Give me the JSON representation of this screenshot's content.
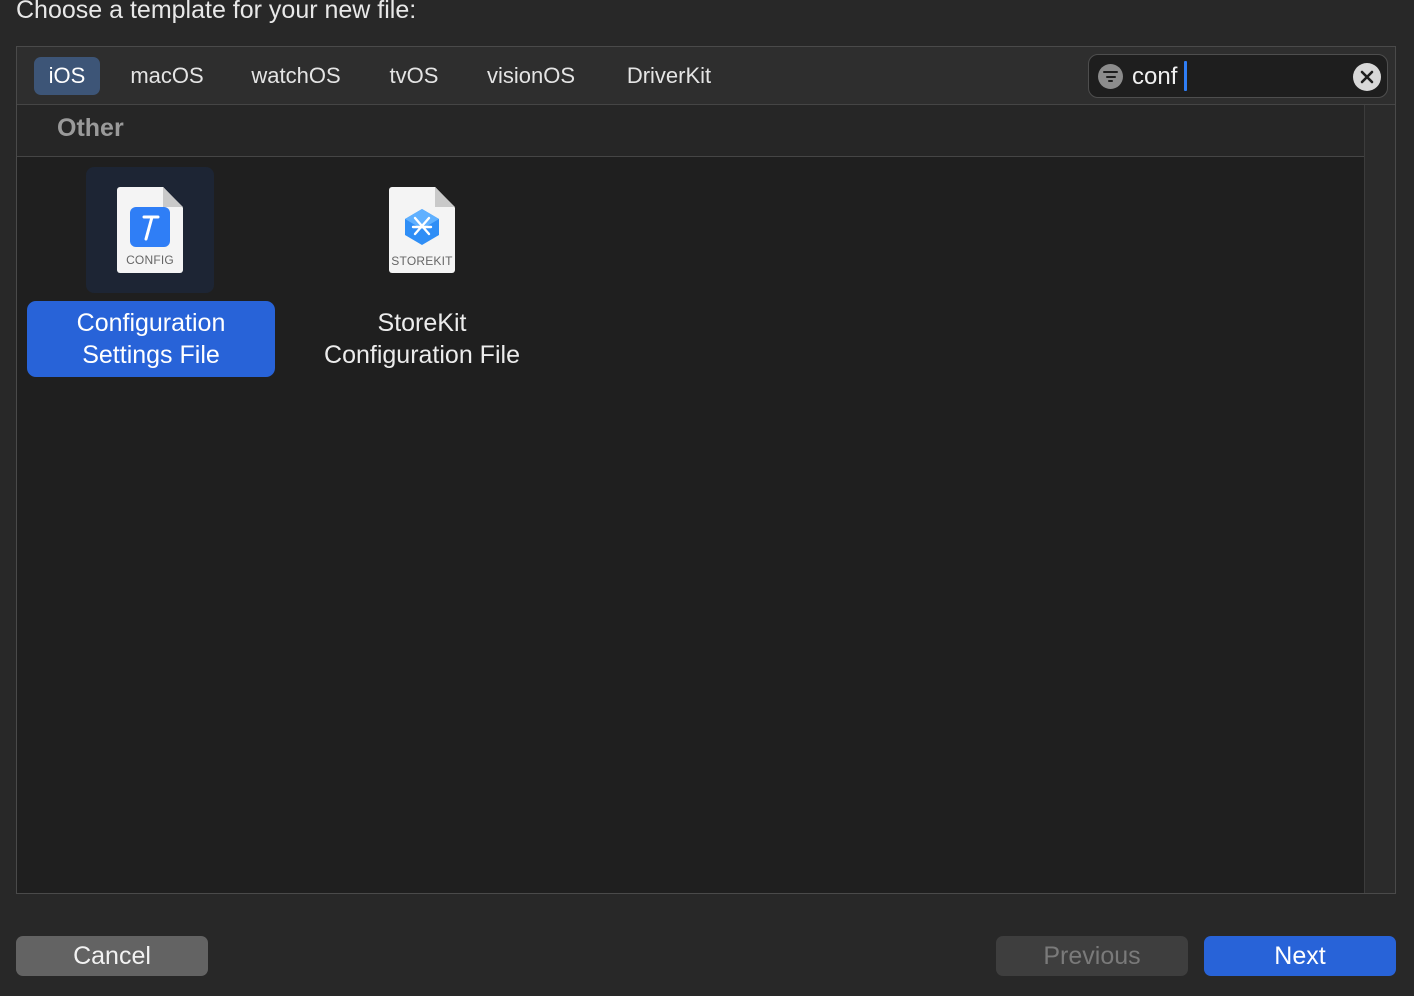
{
  "dialog": {
    "heading": "Choose a template for your new file:"
  },
  "platform_tabs": [
    {
      "label": "iOS",
      "selected": true
    },
    {
      "label": "macOS",
      "selected": false
    },
    {
      "label": "watchOS",
      "selected": false
    },
    {
      "label": "tvOS",
      "selected": false
    },
    {
      "label": "visionOS",
      "selected": false
    },
    {
      "label": "DriverKit",
      "selected": false
    }
  ],
  "search": {
    "value": "conf",
    "filter_icon": "filter-icon",
    "clear_icon": "clear-icon"
  },
  "section": {
    "title": "Other"
  },
  "templates": [
    {
      "name_line1": "Configuration",
      "name_line2": "Settings File",
      "icon_caption": "CONFIG",
      "icon": "config-file-icon",
      "selected": true
    },
    {
      "name_line1": "StoreKit",
      "name_line2": "Configuration File",
      "icon_caption": "STOREKIT",
      "icon": "storekit-file-icon",
      "selected": false
    }
  ],
  "buttons": {
    "cancel": "Cancel",
    "previous": "Previous",
    "next": "Next",
    "previous_enabled": false
  },
  "colors": {
    "accent": "#2863d8",
    "background": "#282828",
    "panel": "#1f1f1f"
  }
}
